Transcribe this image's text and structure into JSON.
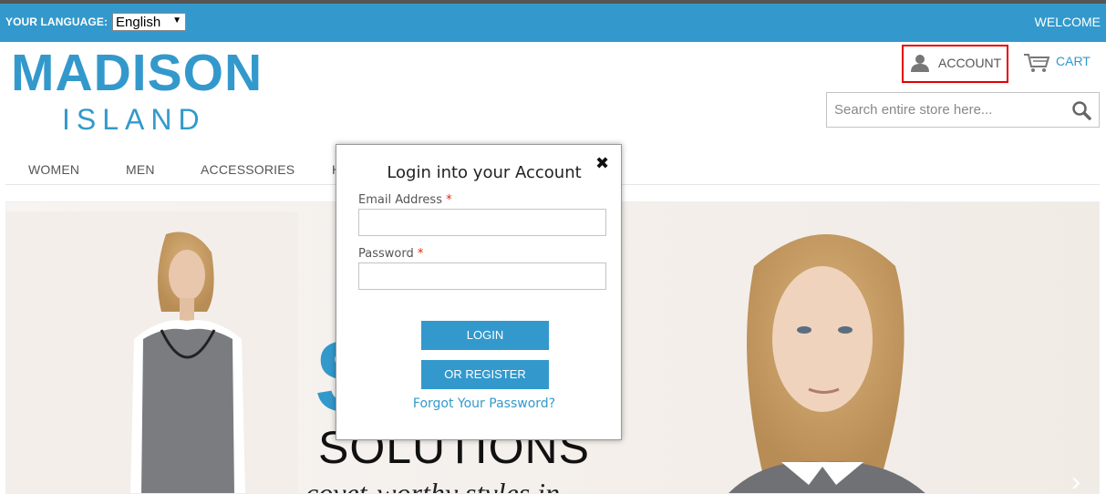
{
  "language": {
    "label": "YOUR LANGUAGE:",
    "selected": "English"
  },
  "header": {
    "welcome": "WELCOME"
  },
  "logo": {
    "main": "MADISON",
    "sub": "ISLAND"
  },
  "account": {
    "label": "ACCOUNT"
  },
  "cart": {
    "label": "CART"
  },
  "search": {
    "placeholder": "Search entire store here..."
  },
  "nav": {
    "items": [
      "WOMEN",
      "MEN",
      "ACCESSORIES",
      "H"
    ]
  },
  "hero": {
    "big_letter": "S",
    "title": "SOLUTIONS",
    "subtitle": "covet-worthy styles in"
  },
  "login_modal": {
    "title": "Login into your Account",
    "close_glyph": "✖",
    "email_label": "Email Address",
    "password_label": "Password",
    "required_mark": "*",
    "login_button": "LOGIN",
    "register_button": "OR REGISTER",
    "forgot_link": "Forgot Your Password?"
  },
  "colors": {
    "brand": "#3399cc",
    "highlight": "#e60000",
    "required": "#df280a"
  }
}
